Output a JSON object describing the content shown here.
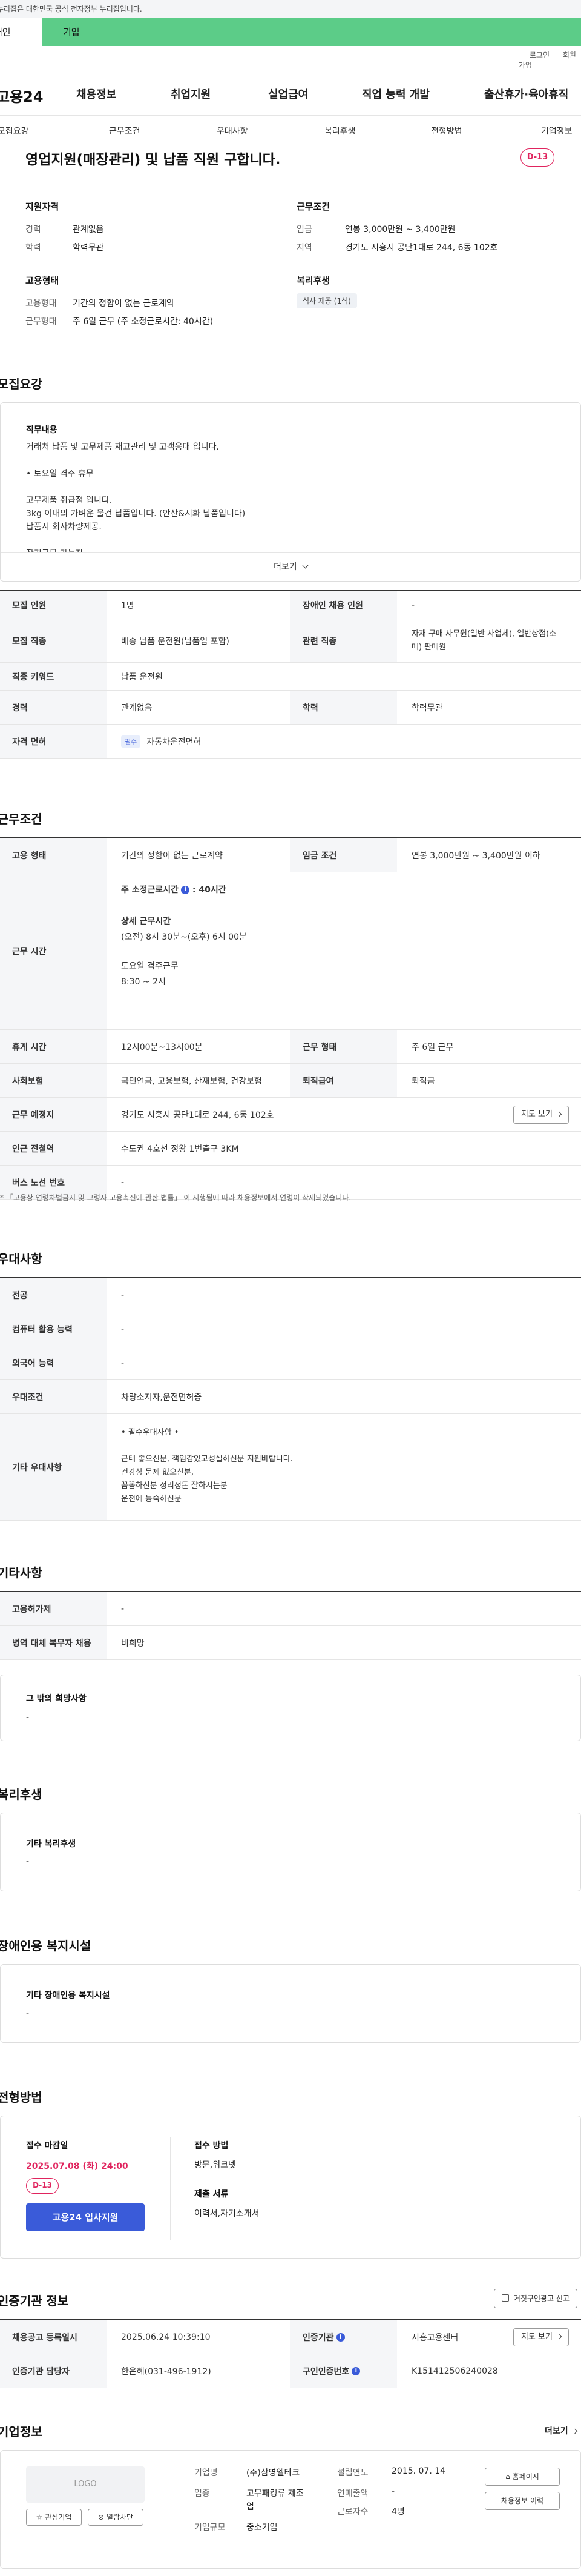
{
  "gov_banner": "이 누리집은 대한민국 공식 전자정부 누리집입니다.",
  "tabs": {
    "person": "개인",
    "company": "기업"
  },
  "util": {
    "login": "로그인",
    "join": "회원가입"
  },
  "logo": "고용24",
  "gnb": [
    "채용정보",
    "취업지원",
    "실업급여",
    "직업 능력 개발",
    "출산휴가·육아휴직"
  ],
  "subnav": [
    "모집요강",
    "근무조건",
    "우대사항",
    "복리후생",
    "전형방법",
    "기업정보"
  ],
  "job": {
    "title": "영업지원(매장관리) 및 납품 직원 구합니다.",
    "dday": "D-13"
  },
  "summary": {
    "qual_head": "지원자격",
    "career_label": "경력",
    "career_value": "관계없음",
    "edu_label": "학력",
    "edu_value": "학력무관",
    "emp_head": "고용형태",
    "emptype_label": "고용형태",
    "emptype_value": "기간의 정함이 없는 근로계약",
    "worktype_label": "근무형태",
    "worktype_value": "주 6일 근무 (주 소정근로시간: 40시간)",
    "cond_head": "근무조건",
    "wage_label": "임금",
    "wage_value": "연봉 3,000만원 ~ 3,400만원",
    "region_label": "지역",
    "region_value": "경기도 시흥시 공단1대로 244, 6동 102호",
    "welfare_head": "복리후생",
    "welfare_chip": "식사 제공 (1식)"
  },
  "recruit": {
    "section_title": "모집요강",
    "duty_head": "직무내용",
    "duty_lines": [
      "거래처 납품 및 고무제품 재고관리 및 고객응대 입니다.",
      "",
      "• 토요일 격주 휴무",
      "",
      "고무제품 취급점 입니다.",
      "3kg 이내의 가벼운 물건 납품입니다. (안산&시화 납품입니다)",
      "납품시 회사차량제공.",
      "",
      "장기근무 가능자"
    ],
    "more": "더보기",
    "rows": {
      "count_label": "모집 인원",
      "count_value": "1명",
      "disabled_label": "장애인 채용 인원",
      "disabled_value": "-",
      "job_label": "모집 직종",
      "job_value": "배송 납품 운전원(납품업 포함)",
      "related_label": "관련 직종",
      "related_value_1": "자재 구매 사무원(일반 사업체), 일반상점(소",
      "related_value_2": "매) 판매원",
      "keyword_label": "직종 키워드",
      "keyword_value": "납품 운전원",
      "career_label": "경력",
      "career_value": "관계없음",
      "edu_label": "학력",
      "edu_value": "학력무관",
      "license_label": "자격 면허",
      "license_tag": "필수",
      "license_value": "자동차운전면허"
    }
  },
  "conditions": {
    "section_title": "근무조건",
    "emptype_label": "고용 형태",
    "emptype_value": "기간의 정함이 없는 근로계약",
    "wage_label": "임금 조건",
    "wage_value": "연봉 3,000만원 ~ 3,400만원 이하",
    "time_label": "근무 시간",
    "time_week": "주 소정근로시간",
    "time_week_val": ": 40시간",
    "time_detail_head": "상세 근무시간",
    "time_detail": "(오전) 8시 30분~(오후) 6시 00분",
    "time_sat": "토요일 격주근무",
    "time_sat_val": "8:30 ~ 2시",
    "break_label": "휴게 시간",
    "break_value": "12시00분~13시00분",
    "form_label": "근무 형태",
    "form_value": "주 6일 근무",
    "insurance_label": "사회보험",
    "insurance_value": "국민연금, 고용보험, 산재보험, 건강보험",
    "retire_label": "퇴직급여",
    "retire_value": "퇴직금",
    "place_label": "근무 예정지",
    "place_value": "경기도 시흥시 공단1대로 244, 6동 102호",
    "map_button": "지도 보기",
    "station_label": "인근 전철역",
    "station_value": "수도권 4호선 정왕 1번출구 3KM",
    "bus_label": "버스 노선 번호",
    "bus_value": "-",
    "note": "* 「고용상 연령차별금지 및 고령자 고용촉진에 관한 법률」 이 시행됨에 따라 채용정보에서 연령이 삭제되었습니다."
  },
  "preferences": {
    "section_title": "우대사항",
    "major_label": "전공",
    "major_value": "-",
    "computer_label": "컴퓨터 활용 능력",
    "computer_value": "-",
    "language_label": "외국어 능력",
    "language_value": "-",
    "pref_label": "우대조건",
    "pref_value": "차량소지자,운전면허증",
    "etc_label": "기타 우대사항",
    "etc_lines": [
      "• 필수우대사항 •",
      "",
      "근태 좋으신분,   책임감있고성실하신분 지원바랍니다.",
      "건강상 문제 없으신분,",
      "꼼꼼하신분 정리정돈 잘하시는분",
      "운전에 능숙하신분"
    ]
  },
  "other": {
    "section_title": "기타사항",
    "hire_label": "고용허가제",
    "hire_value": "-",
    "military_label": "병역 대체 복무자 채용",
    "military_value": "비희망",
    "etc_head": "그 밖의 희망사항",
    "etc_value": "-"
  },
  "welfare": {
    "section_title": "복리후생",
    "head": "기타 복리후생",
    "value": "-"
  },
  "disability": {
    "section_title": "장애인용 복지시설",
    "head": "기타 장애인용 복지시설",
    "value": "-"
  },
  "selection": {
    "section_title": "전형방법",
    "deadline_head": "접수 마감일",
    "deadline_value": "2025.07.08 (화) 24:00",
    "dday": "D-13",
    "apply_button": "고용24 입사지원",
    "method_head": "접수 방법",
    "method_value": "방문,워크넷",
    "docs_head": "제출 서류",
    "docs_value": "이력서,자기소개서"
  },
  "agency": {
    "section_title": "인증기관 정보",
    "report_button": "거짓구인광고 신고",
    "date_label": "채용공고 등록일시",
    "date_value": "2025.06.24 10:39:10",
    "org_label": "인증기관",
    "org_value": "시흥고용센터",
    "map_button": "지도 보기",
    "manager_label": "인증기관 담당자",
    "manager_value": "한은혜(031-496-1912)",
    "id_label": "구인인증번호",
    "id_value": "K151412506240028"
  },
  "company": {
    "section_title": "기업정보",
    "more": "더보기",
    "logo_text": "LOGO",
    "fav_button": "관심기업",
    "block_button": "열람차단",
    "name_label": "기업명",
    "name_value": "(주)삼영엘테크",
    "industry_label": "업종",
    "industry_value_1": "고무패킹류 제조",
    "industry_value_2": "업",
    "size_label": "기업규모",
    "size_value": "중소기업",
    "founded_label": "설립연도",
    "founded_value": "2015. 07. 14",
    "sales_label": "연매출액",
    "sales_value": "-",
    "staff_label": "근로자수",
    "staff_value": "4명",
    "homepage_button": "홈페이지",
    "recruit_button": "채용정보 이력"
  }
}
